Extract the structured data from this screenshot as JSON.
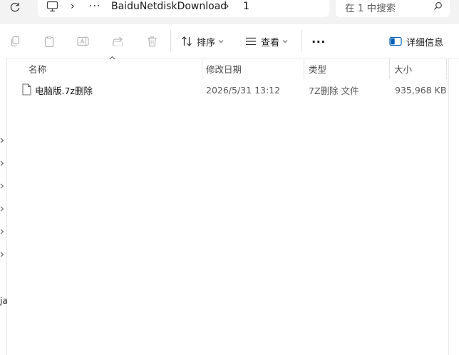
{
  "address_bar": {
    "breadcrumb": [
      "BaiduNetdiskDownload",
      "1"
    ],
    "overflow_label": "···",
    "separator": "›"
  },
  "search": {
    "placeholder": "在 1 中搜索"
  },
  "toolbar": {
    "sort_label": "排序",
    "view_label": "查看",
    "more_label": "···",
    "details_label": "详细信息"
  },
  "nav_pane": {
    "visible_text": "ja"
  },
  "columns": {
    "name": "名称",
    "modified": "修改日期",
    "type": "类型",
    "size": "大小"
  },
  "files": [
    {
      "name": "电脑版.7z删除",
      "modified": "2026/5/31 13:12",
      "type": "7Z删除 文件",
      "size": "935,968 KB"
    }
  ],
  "colors": {
    "bar_bg": "#f3f3f3",
    "accent": "#005fb8"
  }
}
